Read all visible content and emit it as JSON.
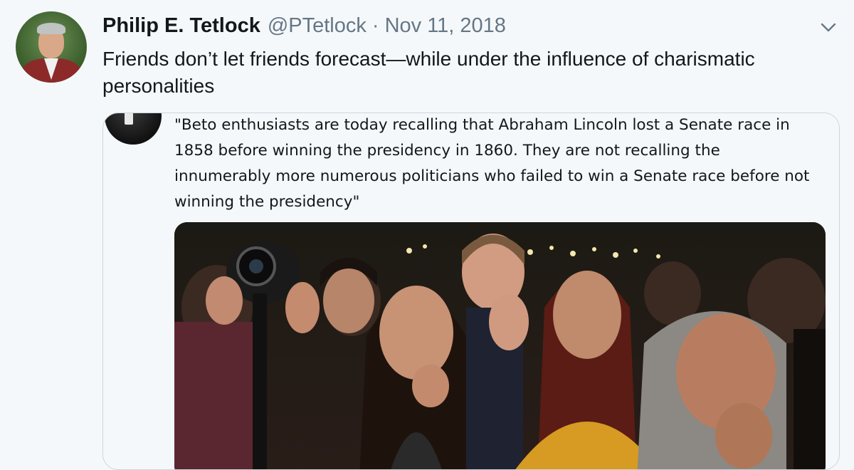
{
  "tweet": {
    "author_name": "Philip E. Tetlock",
    "author_handle": "@PTetlock",
    "separator": "·",
    "date": "Nov 11, 2018",
    "text": "Friends don’t let friends forecast—while under the influence of charismatic personalities"
  },
  "quoted_tweet": {
    "text": "\"Beto enthusiasts are today recalling that Abraham Lincoln lost a Senate race in 1858 before winning the presidency in 1860. They are not recalling the innumerably more numerous politicians who failed to win a Senate race before not winning the presidency\""
  },
  "icons": {
    "menu": "chevron-down-icon"
  },
  "colors": {
    "background": "#f5f8fa",
    "text": "#14171a",
    "secondary_text": "#657786",
    "border": "#ccd6dd"
  }
}
